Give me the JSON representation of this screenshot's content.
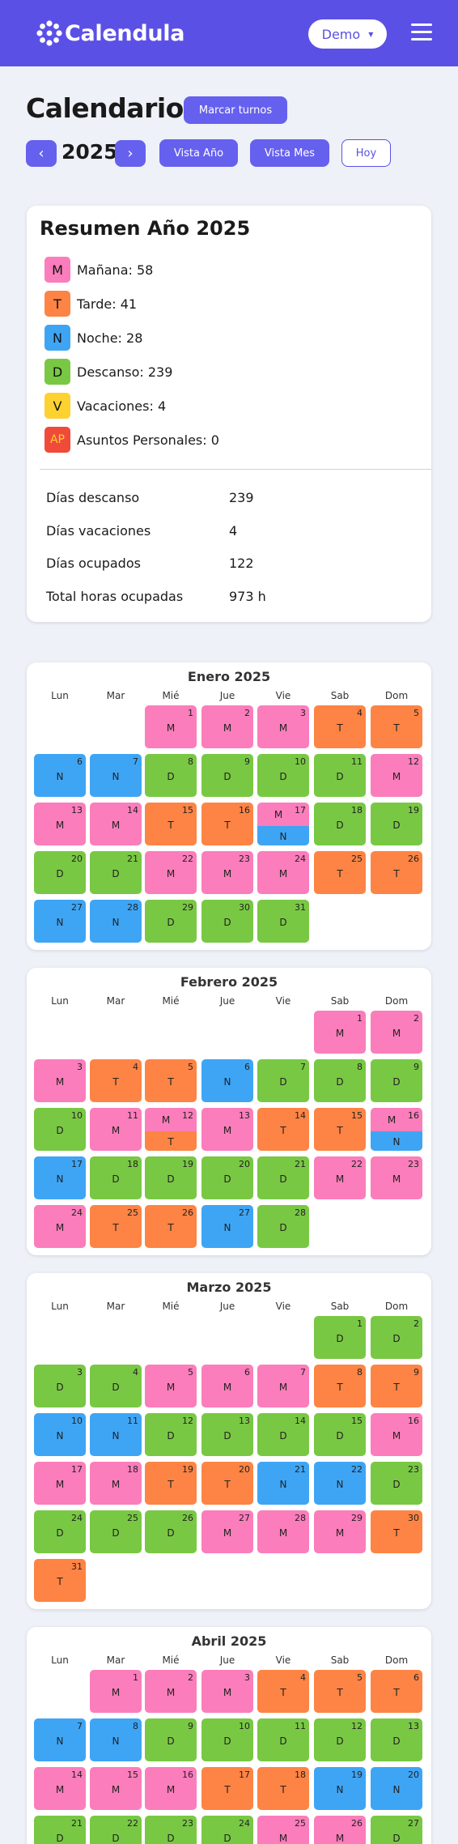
{
  "app": {
    "name": "Calendula",
    "demo_label": "Demo"
  },
  "colors": {
    "brand": "#5b50e6",
    "M": "#fb7dbb",
    "T": "#fd8444",
    "N": "#3ea5f5",
    "D": "#79c844",
    "V": "#fdd12f",
    "AP": "#f04a3a"
  },
  "header": {
    "title": "Calendario",
    "mark_shifts_label": "Marcar turnos",
    "prev_label": "‹",
    "next_label": "›",
    "year": "2025",
    "view_year_label": "Vista Año",
    "view_month_label": "Vista Mes",
    "today_label": "Hoy"
  },
  "summary": {
    "title": "Resumen Año 2025",
    "legend": [
      {
        "code": "M",
        "label": "Mañana:",
        "count": "58"
      },
      {
        "code": "T",
        "label": "Tarde:",
        "count": "41"
      },
      {
        "code": "N",
        "label": "Noche:",
        "count": "28"
      },
      {
        "code": "D",
        "label": "Descanso:",
        "count": "239"
      },
      {
        "code": "V",
        "label": "Vacaciones:",
        "count": "4"
      },
      {
        "code": "AP",
        "label": "Asuntos Personales:",
        "count": "0"
      }
    ],
    "stats": [
      {
        "label": "Días descanso",
        "value": "239"
      },
      {
        "label": "Días vacaciones",
        "value": "4"
      },
      {
        "label": "Días ocupados",
        "value": "122"
      },
      {
        "label": "Total horas ocupadas",
        "value": "973 h"
      }
    ]
  },
  "weekdays": [
    "Lun",
    "Mar",
    "Mié",
    "Jue",
    "Vie",
    "Sab",
    "Dom"
  ],
  "months": [
    {
      "name": "Enero 2025",
      "offset": 2,
      "days": [
        "M",
        "M",
        "M",
        "T",
        "T",
        "N",
        "N",
        "D",
        "D",
        "D",
        "D",
        "M",
        "M",
        "M",
        "T",
        "T",
        "M/N",
        "D",
        "D",
        "D",
        "D",
        "M",
        "M",
        "M",
        "T",
        "T",
        "N",
        "N",
        "D",
        "D",
        "D"
      ]
    },
    {
      "name": "Febrero 2025",
      "offset": 5,
      "days": [
        "M",
        "M",
        "M",
        "T",
        "T",
        "N",
        "D",
        "D",
        "D",
        "D",
        "M",
        "M/T",
        "M",
        "T",
        "T",
        "M/N",
        "N",
        "D",
        "D",
        "D",
        "D",
        "M",
        "M",
        "M",
        "T",
        "T",
        "N",
        "D"
      ]
    },
    {
      "name": "Marzo 2025",
      "offset": 5,
      "days": [
        "D",
        "D",
        "D",
        "D",
        "M",
        "M",
        "M",
        "T",
        "T",
        "N",
        "N",
        "D",
        "D",
        "D",
        "D",
        "M",
        "M",
        "M",
        "T",
        "T",
        "N",
        "N",
        "D",
        "D",
        "D",
        "D",
        "M",
        "M",
        "M",
        "T",
        "T"
      ]
    },
    {
      "name": "Abril 2025",
      "offset": 1,
      "days": [
        "M",
        "M",
        "M",
        "T",
        "T",
        "T",
        "N",
        "N",
        "D",
        "D",
        "D",
        "D",
        "D",
        "M",
        "M",
        "M",
        "T",
        "T",
        "N",
        "N",
        "D",
        "D",
        "D",
        "D",
        "M",
        "M",
        "D"
      ]
    }
  ]
}
